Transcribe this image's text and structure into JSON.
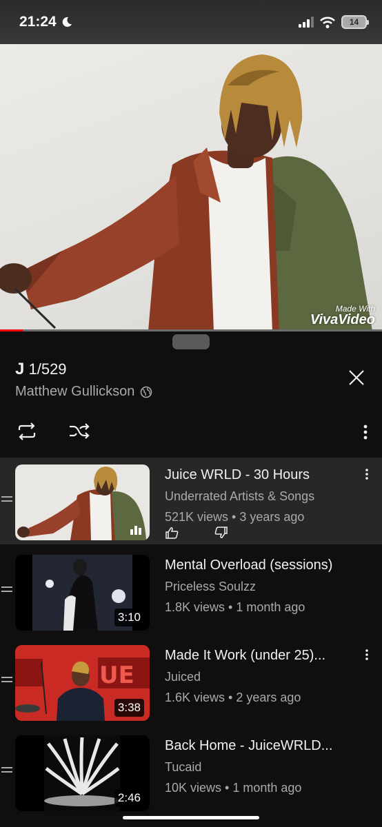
{
  "status_bar": {
    "time": "21:24",
    "battery_level": "14"
  },
  "player": {
    "watermark_line1": "Made With",
    "watermark_line2": "VivaVideo",
    "progress_fraction": 0.06
  },
  "playlist": {
    "title_letter": "J",
    "position": "1/529",
    "owner": "Matthew Gullickson"
  },
  "videos": [
    {
      "title": "Juice WRLD - 30 Hours",
      "channel": "Underrated Artists & Songs",
      "meta": "521K views • 3 years ago",
      "duration": "",
      "playing": true
    },
    {
      "title": "Mental Overload (sessions)",
      "channel": "Priceless Soulzz",
      "meta": "1.8K views • 1 month ago",
      "duration": "3:10",
      "playing": false
    },
    {
      "title": "Made It Work (under 25)...",
      "channel": "Juiced",
      "meta": "1.6K views • 2 years ago",
      "duration": "3:38",
      "playing": false
    },
    {
      "title": "Back Home - JuiceWRLD...",
      "channel": "Tucaid",
      "meta": "10K views • 1 month ago",
      "duration": "2:46",
      "playing": false
    }
  ],
  "colors": {
    "background": "#0f0f0f",
    "active_row": "#272727",
    "progress": "#ff0000",
    "secondary_text": "#aaaaaa"
  }
}
